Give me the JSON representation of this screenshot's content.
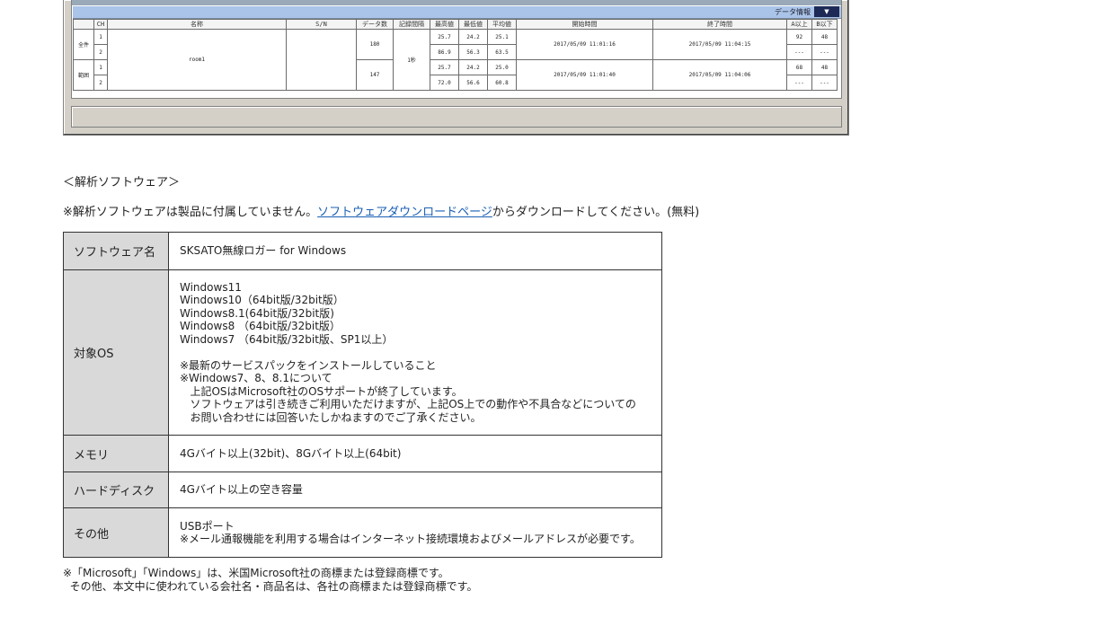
{
  "screenshot": {
    "data_info_label": "データ情報",
    "data_info_button": "▼",
    "columns": [
      "CH",
      "名称",
      "S/N",
      "データ数",
      "記録間隔",
      "最高値",
      "最低値",
      "平均値",
      "開始時間",
      "終了時間",
      "A以上",
      "B以下"
    ],
    "groups": [
      {
        "label": "全件",
        "name": "room1",
        "count": "180",
        "interval": "1秒",
        "start": "2017/05/09 11:01:16",
        "end": "2017/05/09 11:04:15",
        "rows": [
          {
            "ch": "1",
            "max": "25.7",
            "min": "24.2",
            "avg": "25.1",
            "a": "92",
            "b": "48"
          },
          {
            "ch": "2",
            "max": "86.9",
            "min": "56.3",
            "avg": "63.5",
            "a": "---",
            "b": "---"
          }
        ]
      },
      {
        "label": "範囲",
        "count": "147",
        "start": "2017/05/09 11:01:40",
        "end": "2017/05/09 11:04:06",
        "rows": [
          {
            "ch": "1",
            "max": "25.7",
            "min": "24.2",
            "avg": "25.0",
            "a": "68",
            "b": "48"
          },
          {
            "ch": "2",
            "max": "72.0",
            "min": "56.6",
            "avg": "60.8",
            "a": "---",
            "b": "---"
          }
        ]
      }
    ]
  },
  "section_title": "＜解析ソフトウェア＞",
  "note": {
    "prefix": "※解析ソフトウェアは製品に付属していません。",
    "link": "ソフトウェアダウンロードページ",
    "suffix": "からダウンロードしてください。(無料)"
  },
  "spec": {
    "software_name": {
      "label": "ソフトウェア名",
      "value": "SKSATO無線ロガー for Windows"
    },
    "os": {
      "label": "対象OS",
      "lines": [
        "Windows11",
        "Windows10（64bit版/32bit版）",
        "Windows8.1(64bit版/32bit版)",
        "Windows8 （64bit版/32bit版）",
        "Windows7 （64bit版/32bit版、SP1以上）",
        "",
        "※最新のサービスパックをインストールしていること",
        "※Windows7、8、8.1について",
        "   上記OSはMicrosoft社のOSサポートが終了しています。",
        "   ソフトウェアは引き続きご利用いただけますが、上記OS上での動作や不具合などについての",
        "   お問い合わせには回答いたしかねますのでご了承ください。"
      ]
    },
    "memory": {
      "label": "メモリ",
      "value": "4Gバイト以上(32bit)、8Gバイト以上(64bit)"
    },
    "disk": {
      "label": "ハードディスク",
      "value": "4Gバイト以上の空き容量"
    },
    "other": {
      "label": "その他",
      "lines": [
        "USBポート",
        "※メール通報機能を利用する場合はインターネット接続環境およびメールアドレスが必要です。"
      ]
    }
  },
  "footnote": {
    "line1": "※「Microsoft」「Windows」は、米国Microsoft社の商標または登録商標です。",
    "line2": "  その他、本文中に使われている会社名・商品名は、各社の商標または登録商標です。"
  }
}
